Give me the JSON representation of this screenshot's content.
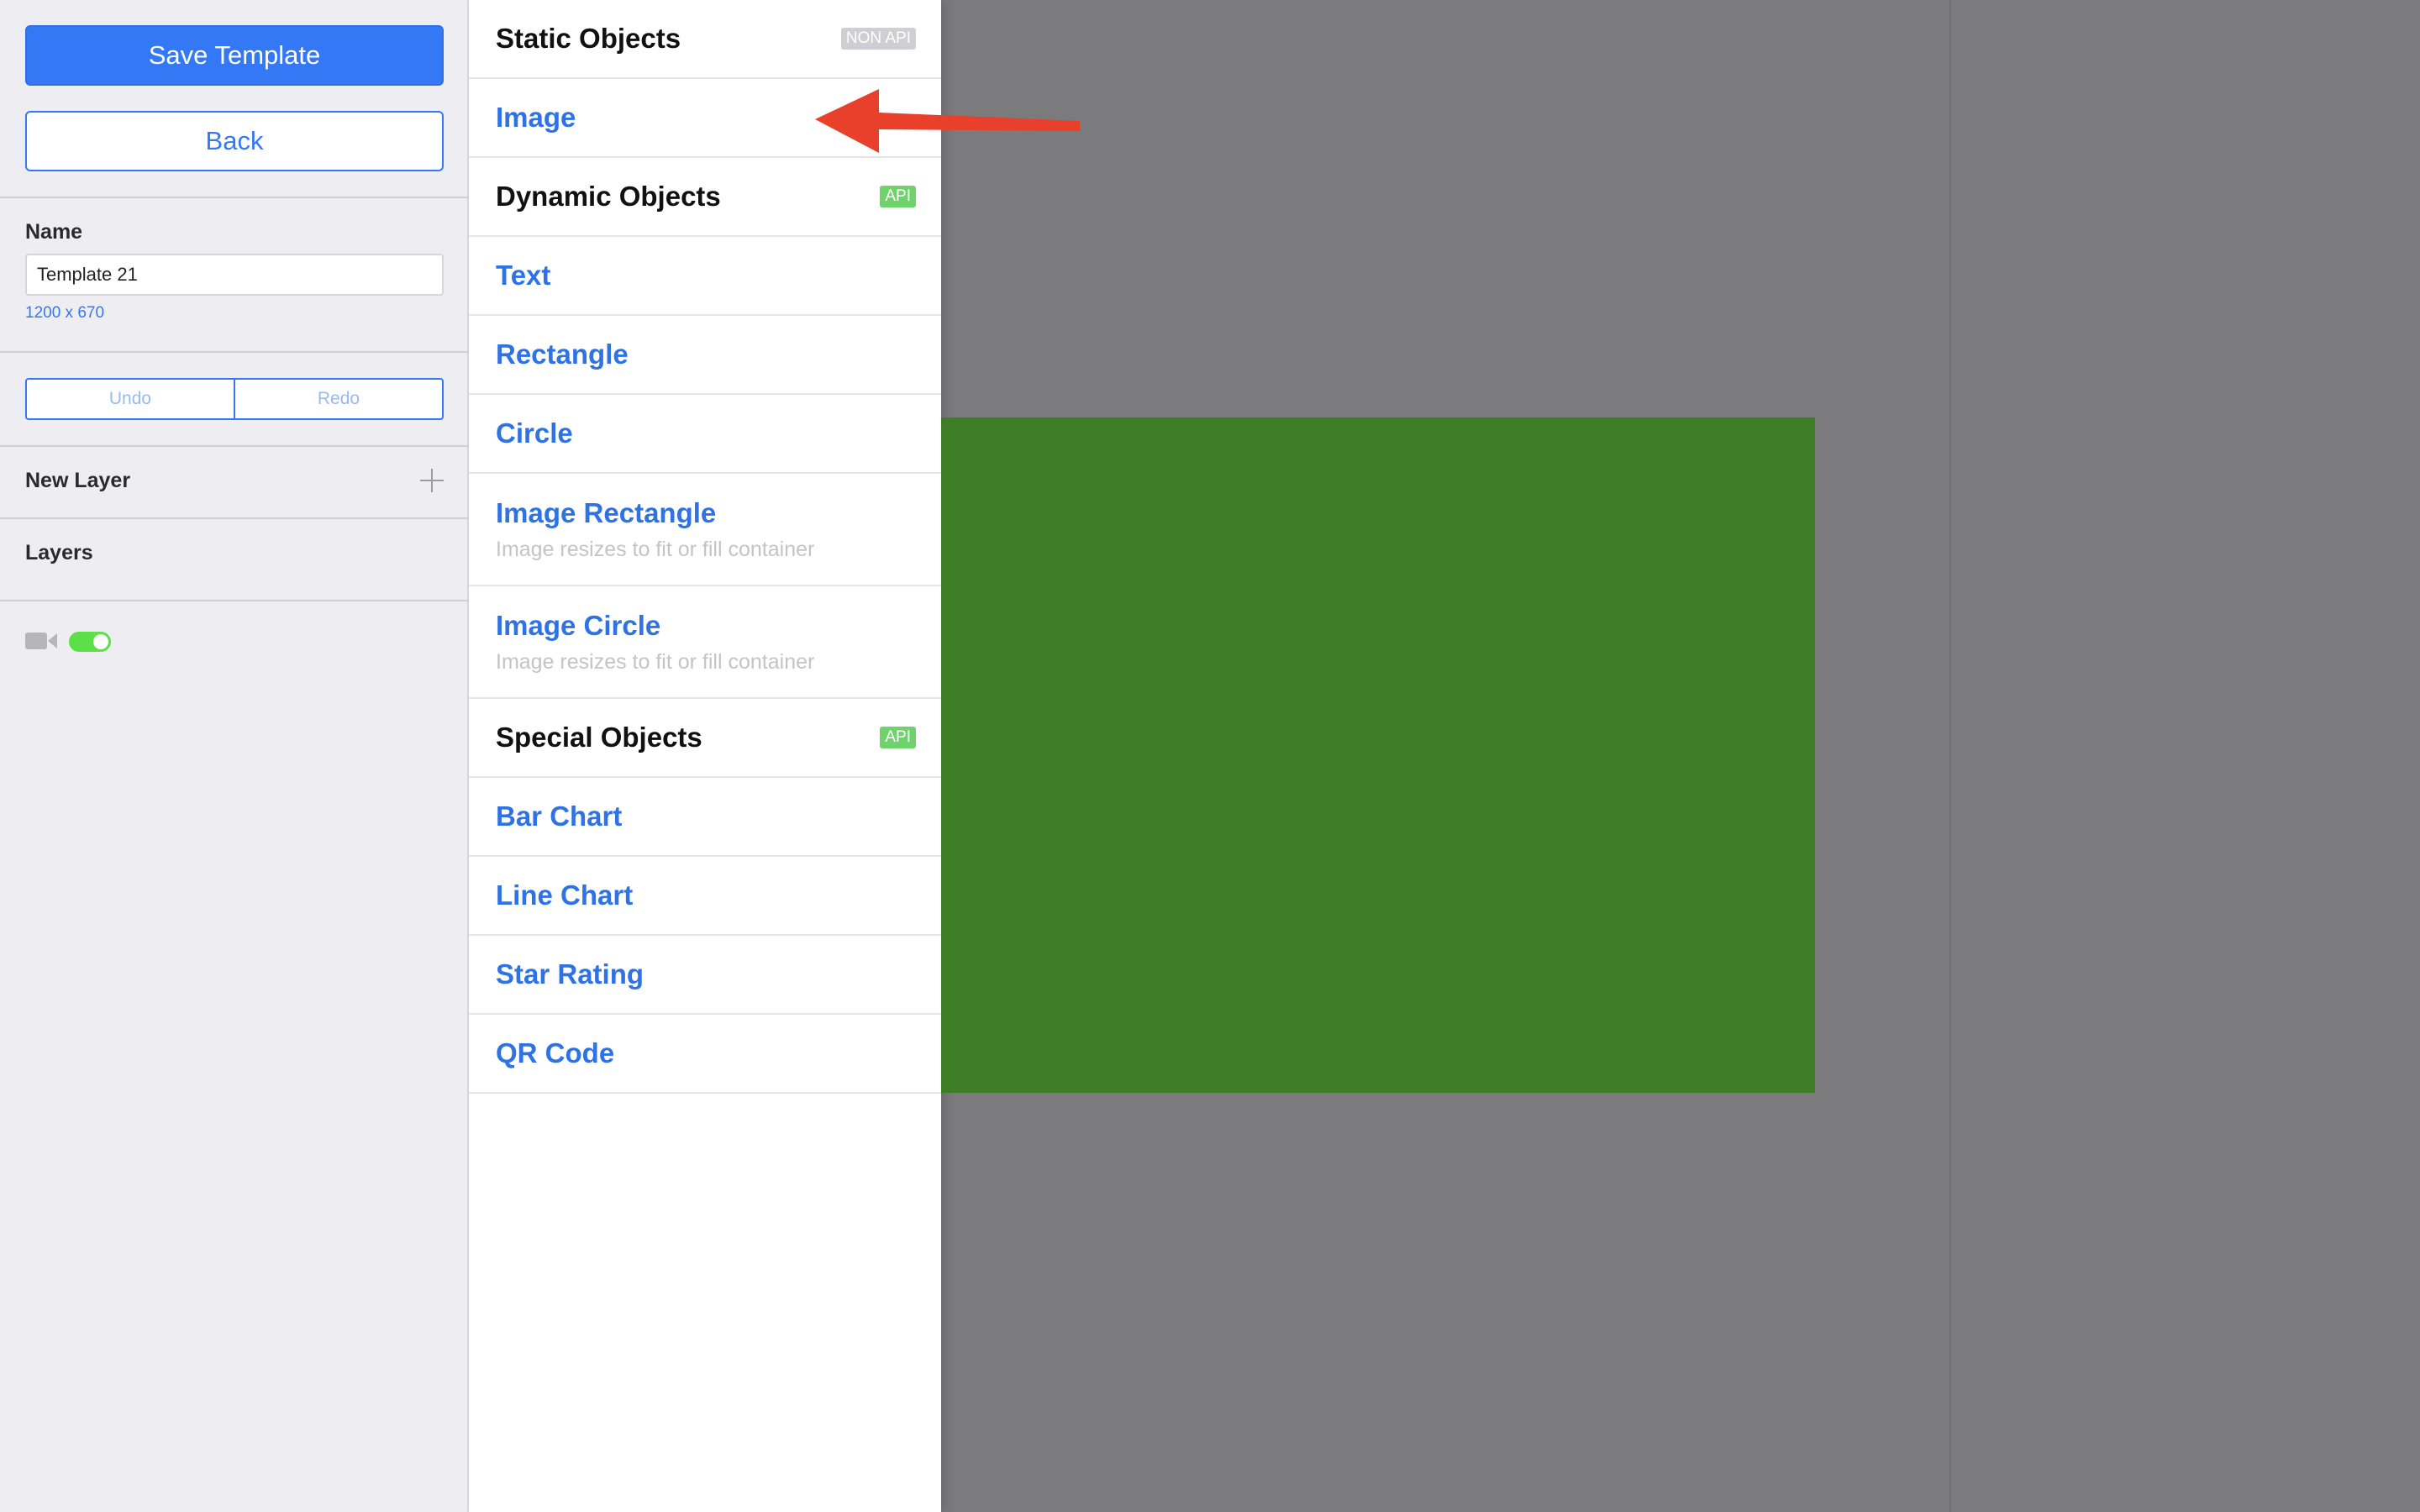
{
  "sidebar": {
    "save_label": "Save Template",
    "back_label": "Back",
    "name_label": "Name",
    "name_value": "Template 21",
    "dimensions": "1200 x 670",
    "undo_label": "Undo",
    "redo_label": "Redo",
    "new_layer_label": "New Layer",
    "layers_label": "Layers",
    "video_toggle_on": true
  },
  "menu": {
    "static_header": "Static Objects",
    "static_badge": "NON API",
    "image": "Image",
    "dynamic_header": "Dynamic Objects",
    "dynamic_badge": "API",
    "text": "Text",
    "rectangle": "Rectangle",
    "circle": "Circle",
    "image_rectangle": "Image Rectangle",
    "image_rectangle_sub": "Image resizes to fit or fill container",
    "image_circle": "Image Circle",
    "image_circle_sub": "Image resizes to fit or fill container",
    "special_header": "Special Objects",
    "special_badge": "API",
    "bar_chart": "Bar Chart",
    "line_chart": "Line Chart",
    "star_rating": "Star Rating",
    "qr_code": "QR Code"
  },
  "colors": {
    "accent": "#3478f6",
    "canvas_fill": "#3d7d26",
    "annotation_arrow": "#e8402a",
    "toggle_on": "#5ddf4a"
  }
}
